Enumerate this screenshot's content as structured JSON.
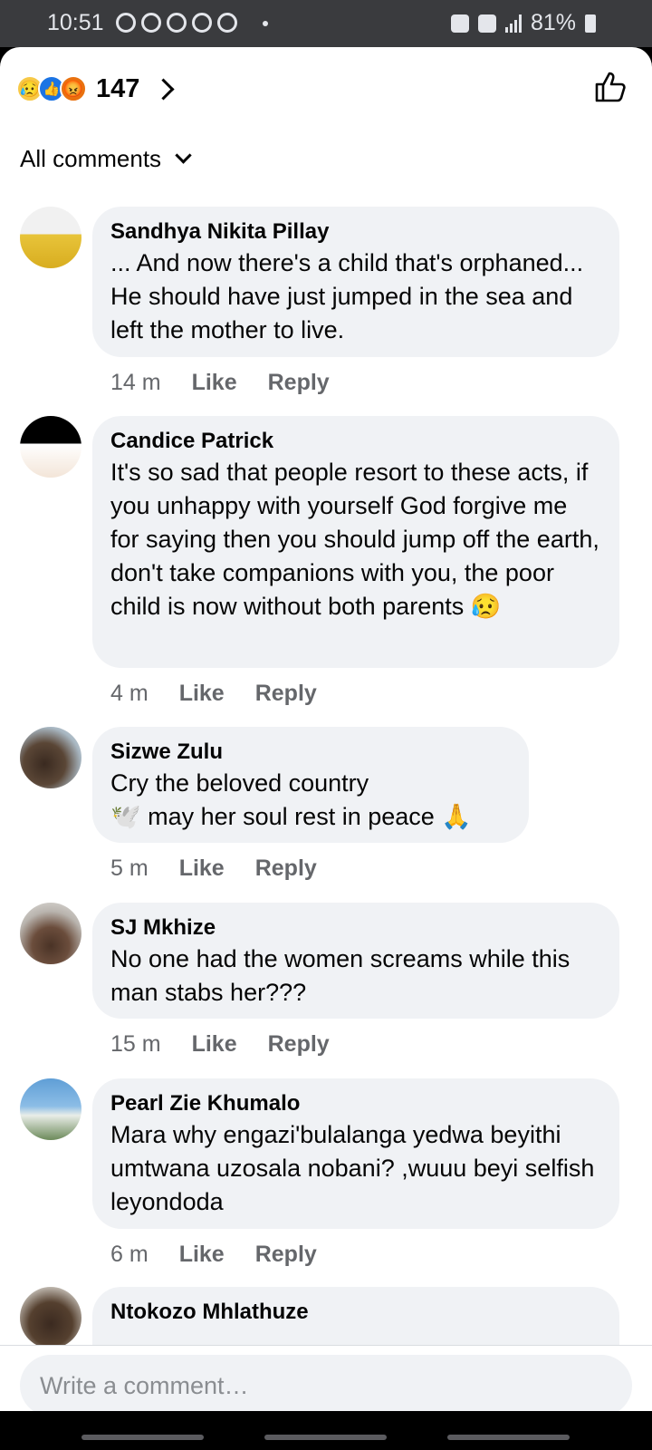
{
  "status_bar": {
    "time": "10:51",
    "battery": "81%"
  },
  "header": {
    "reactions": [
      "sad",
      "like",
      "angry"
    ],
    "reaction_count": "147",
    "like_icon": "thumbs-up-outline-icon"
  },
  "filter": {
    "label": "All comments"
  },
  "comments": [
    {
      "author": "Sandhya Nikita Pillay",
      "text": "... And now there's a child that's orphaned... He should have just jumped in the sea and left the mother to live.",
      "time": "14 m",
      "like": "Like",
      "reply": "Reply"
    },
    {
      "author": "Candice Patrick",
      "text": "It's so sad that people resort to these acts, if you unhappy with yourself God forgive me for saying then you should jump off the earth, don't take companions with you, the poor child is now without both parents 😥",
      "time": "4 m",
      "like": "Like",
      "reply": "Reply"
    },
    {
      "author": "Sizwe Zulu",
      "text": "Cry the beloved country\n🕊️ may her soul rest in peace 🙏",
      "time": "5 m",
      "like": "Like",
      "reply": "Reply"
    },
    {
      "author": "SJ Mkhize",
      "text": "No one had the women screams while this man stabs her???",
      "time": "15 m",
      "like": "Like",
      "reply": "Reply"
    },
    {
      "author": "Pearl Zie Khumalo",
      "text": "Mara why engazi'bulalanga yedwa beyithi umtwana uzosala nobani? ,wuuu beyi selfish leyondoda",
      "time": "6 m",
      "like": "Like",
      "reply": "Reply"
    },
    {
      "author": "Ntokozo Mhlathuze"
    }
  ],
  "composer": {
    "placeholder": "Write a comment…"
  }
}
